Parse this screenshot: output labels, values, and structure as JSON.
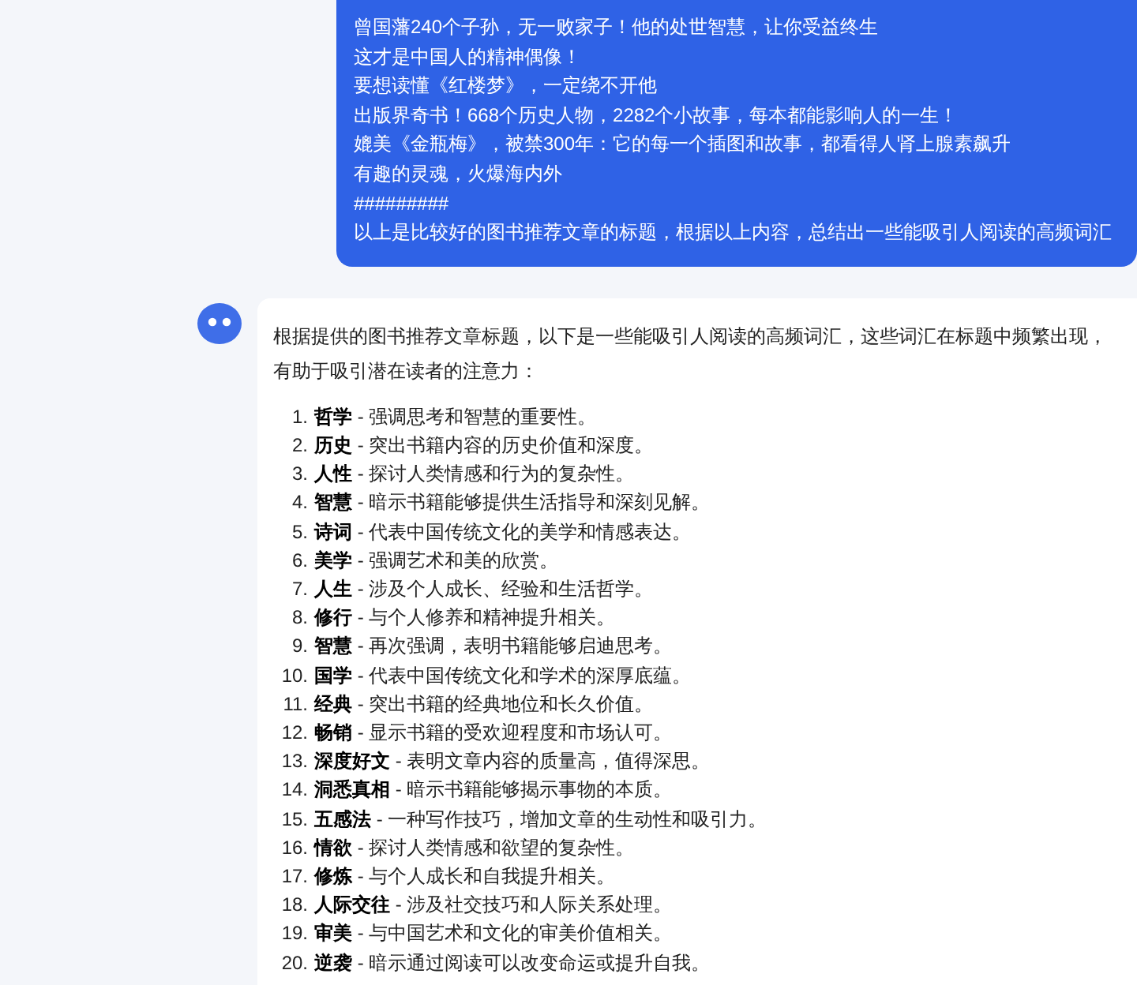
{
  "user_message": {
    "lines": [
      "曾国藩240个子孙，无一败家子！他的处世智慧，让你受益终生",
      "这才是中国人的精神偶像！",
      "要想读懂《红楼梦》，一定绕不开他",
      "出版界奇书！668个历史人物，2282个小故事，每本都能影响人的一生！",
      "媲美《金瓶梅》，被禁300年：它的每一个插图和故事，都看得人肾上腺素飙升",
      "有趣的灵魂，火爆海内外",
      "#########",
      "以上是比较好的图书推荐文章的标题，根据以上内容，总结出一些能吸引人阅读的高频词汇"
    ]
  },
  "bot_message": {
    "intro": "根据提供的图书推荐文章标题，以下是一些能吸引人阅读的高频词汇，这些词汇在标题中频繁出现，有助于吸引潜在读者的注意力：",
    "items": [
      {
        "number": "1.",
        "term": "哲学",
        "desc": " - 强调思考和智慧的重要性。"
      },
      {
        "number": "2.",
        "term": "历史",
        "desc": " - 突出书籍内容的历史价值和深度。"
      },
      {
        "number": "3.",
        "term": "人性",
        "desc": " - 探讨人类情感和行为的复杂性。"
      },
      {
        "number": "4.",
        "term": "智慧",
        "desc": " - 暗示书籍能够提供生活指导和深刻见解。"
      },
      {
        "number": "5.",
        "term": "诗词",
        "desc": " - 代表中国传统文化的美学和情感表达。"
      },
      {
        "number": "6.",
        "term": "美学",
        "desc": " - 强调艺术和美的欣赏。"
      },
      {
        "number": "7.",
        "term": "人生",
        "desc": " - 涉及个人成长、经验和生活哲学。"
      },
      {
        "number": "8.",
        "term": "修行",
        "desc": " - 与个人修养和精神提升相关。"
      },
      {
        "number": "9.",
        "term": "智慧",
        "desc": " - 再次强调，表明书籍能够启迪思考。"
      },
      {
        "number": "10.",
        "term": "国学",
        "desc": " - 代表中国传统文化和学术的深厚底蕴。"
      },
      {
        "number": "11.",
        "term": "经典",
        "desc": " - 突出书籍的经典地位和长久价值。"
      },
      {
        "number": "12.",
        "term": "畅销",
        "desc": " - 显示书籍的受欢迎程度和市场认可。"
      },
      {
        "number": "13.",
        "term": "深度好文",
        "desc": " - 表明文章内容的质量高，值得深思。"
      },
      {
        "number": "14.",
        "term": "洞悉真相",
        "desc": " - 暗示书籍能够揭示事物的本质。"
      },
      {
        "number": "15.",
        "term": "五感法",
        "desc": " - 一种写作技巧，增加文章的生动性和吸引力。"
      },
      {
        "number": "16.",
        "term": "情欲",
        "desc": " - 探讨人类情感和欲望的复杂性。"
      },
      {
        "number": "17.",
        "term": "修炼",
        "desc": " - 与个人成长和自我提升相关。"
      },
      {
        "number": "18.",
        "term": "人际交往",
        "desc": " - 涉及社交技巧和人际关系处理。"
      },
      {
        "number": "19.",
        "term": "审美",
        "desc": " - 与中国艺术和文化的审美价值相关。"
      },
      {
        "number": "20.",
        "term": "逆袭",
        "desc": " - 暗示通过阅读可以改变命运或提升自我。"
      }
    ]
  }
}
